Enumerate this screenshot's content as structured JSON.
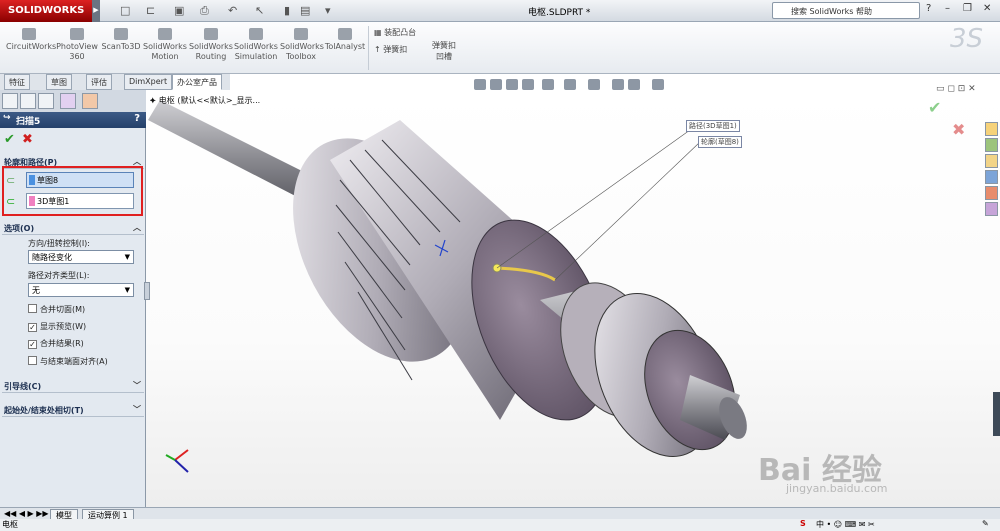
{
  "app": {
    "logo": "SOLIDWORKS",
    "doc_title": "电枢.SLDPRT *",
    "search_placeholder": "搜索 SolidWorks 帮助"
  },
  "ribbon": {
    "buttons": [
      {
        "label": "CircuitWorks"
      },
      {
        "label": "PhotoView\n360"
      },
      {
        "label": "ScanTo3D"
      },
      {
        "label": "SolidWorks\nMotion"
      },
      {
        "label": "SolidWorks\nRouting"
      },
      {
        "label": "SolidWorks\nSimulation"
      },
      {
        "label": "SolidWorks\nToolbox"
      },
      {
        "label": "TolAnalyst"
      }
    ],
    "small_1": "装配凸台",
    "small_2": "弹簧扣",
    "small_3": "弹簧扣\n凹槽"
  },
  "tabs": [
    "特征",
    "草图",
    "评估",
    "DimXpert",
    "办公室产品"
  ],
  "tree_label": "电枢 (默认<<默认>_显示...",
  "panel": {
    "title": "扫描5",
    "help": "?",
    "sec_profile": "轮廓和路径(P)",
    "profile": "草图8",
    "path": "3D草图1",
    "sec_options": "选项(O)",
    "orient_label": "方向/扭转控制(I):",
    "orient_value": "随路径变化",
    "align_label": "路径对齐类型(L):",
    "align_value": "无",
    "cb1": "合并切面(M)",
    "cb2": "显示预览(W)",
    "cb3": "合并结果(R)",
    "cb4": "与结束端面对齐(A)",
    "sec_guides": "引导线(C)",
    "sec_tangency": "起始处/结束处相切(T)"
  },
  "annotations": {
    "path": "路径(3D草图1)",
    "profile": "轮廓(草图8)"
  },
  "bottom_tabs": [
    "模型",
    "运动算例 1"
  ],
  "status_text": "电枢",
  "watermark": {
    "main": "Bai 经验",
    "sub": "jingyan.baidu.com"
  }
}
